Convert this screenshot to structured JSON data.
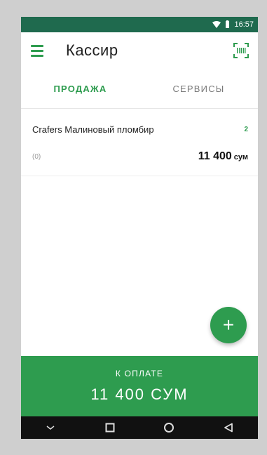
{
  "status": {
    "time": "16:57"
  },
  "appbar": {
    "title": "Кассир"
  },
  "tabs": [
    {
      "label": "ПРОДАЖА",
      "active": true
    },
    {
      "label": "СЕРВИСЫ",
      "active": false
    }
  ],
  "items": [
    {
      "name": "Crafers Малиновый пломбир",
      "qty": "2",
      "note": "(0)",
      "price": "11 400",
      "currency": "сум"
    }
  ],
  "fab": {
    "label": "+"
  },
  "pay": {
    "label": "К ОПЛАТЕ",
    "amount": "11 400 СУМ"
  },
  "colors": {
    "accent": "#2e9c4f",
    "statusbar": "#1f6a4e"
  }
}
